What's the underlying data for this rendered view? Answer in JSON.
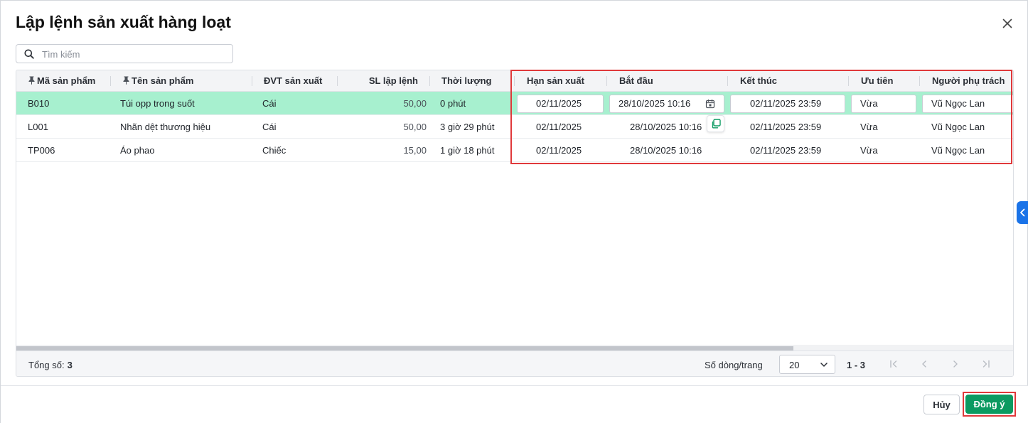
{
  "dialog": {
    "title": "Lập lệnh sản xuất hàng loạt",
    "close_icon": "close-icon"
  },
  "search": {
    "placeholder": "Tìm kiếm",
    "value": "",
    "icon": "search-icon"
  },
  "table": {
    "columns": [
      {
        "key": "code",
        "label": "Mã sản phẩm",
        "pinned": true
      },
      {
        "key": "name",
        "label": "Tên sản phẩm",
        "pinned": true
      },
      {
        "key": "unit",
        "label": "ĐVT sản xuất",
        "pinned": false
      },
      {
        "key": "qty",
        "label": "SL lập lệnh",
        "pinned": false
      },
      {
        "key": "duration",
        "label": "Thời lượng",
        "pinned": false
      },
      {
        "key": "deadline",
        "label": "Hạn sản xuất",
        "pinned": false
      },
      {
        "key": "start",
        "label": "Bắt đầu",
        "pinned": false
      },
      {
        "key": "end",
        "label": "Kết thúc",
        "pinned": false
      },
      {
        "key": "priority",
        "label": "Ưu tiên",
        "pinned": false
      },
      {
        "key": "owner",
        "label": "Người phụ trách",
        "pinned": false
      }
    ],
    "rows": [
      {
        "code": "B010",
        "name": "Túi opp trong suốt",
        "unit": "Cái",
        "qty": "50,00",
        "duration": "0 phút",
        "deadline": "02/11/2025",
        "start": "28/10/2025 10:16",
        "end": "02/11/2025 23:59",
        "priority": "Vừa",
        "owner": "Vũ Ngọc Lan"
      },
      {
        "code": "L001",
        "name": "Nhãn dệt thương hiệu",
        "unit": "Cái",
        "qty": "50,00",
        "duration": "3 giờ 29 phút",
        "deadline": "02/11/2025",
        "start": "28/10/2025 10:16",
        "end": "02/11/2025 23:59",
        "priority": "Vừa",
        "owner": "Vũ Ngọc Lan"
      },
      {
        "code": "TP006",
        "name": "Áo phao",
        "unit": "Chiếc",
        "qty": "15,00",
        "duration": "1 giờ 18 phút",
        "deadline": "02/11/2025",
        "start": "28/10/2025 10:16",
        "end": "02/11/2025 23:59",
        "priority": "Vừa",
        "owner": "Vũ Ngọc Lan"
      }
    ],
    "selected_row": 0
  },
  "footer": {
    "total_label": "Tổng số:",
    "total_value": "3",
    "rows_per_page_label": "Số dòng/trang",
    "rows_per_page_value": "20",
    "range": "1 - 3"
  },
  "actions": {
    "cancel_label": "Hủy",
    "ok_label": "Đồng ý"
  },
  "colors": {
    "accent": "#0b9a61",
    "selected_row": "#a7f0cf",
    "highlight": "#e0393b",
    "side_tab": "#1a73e8"
  }
}
